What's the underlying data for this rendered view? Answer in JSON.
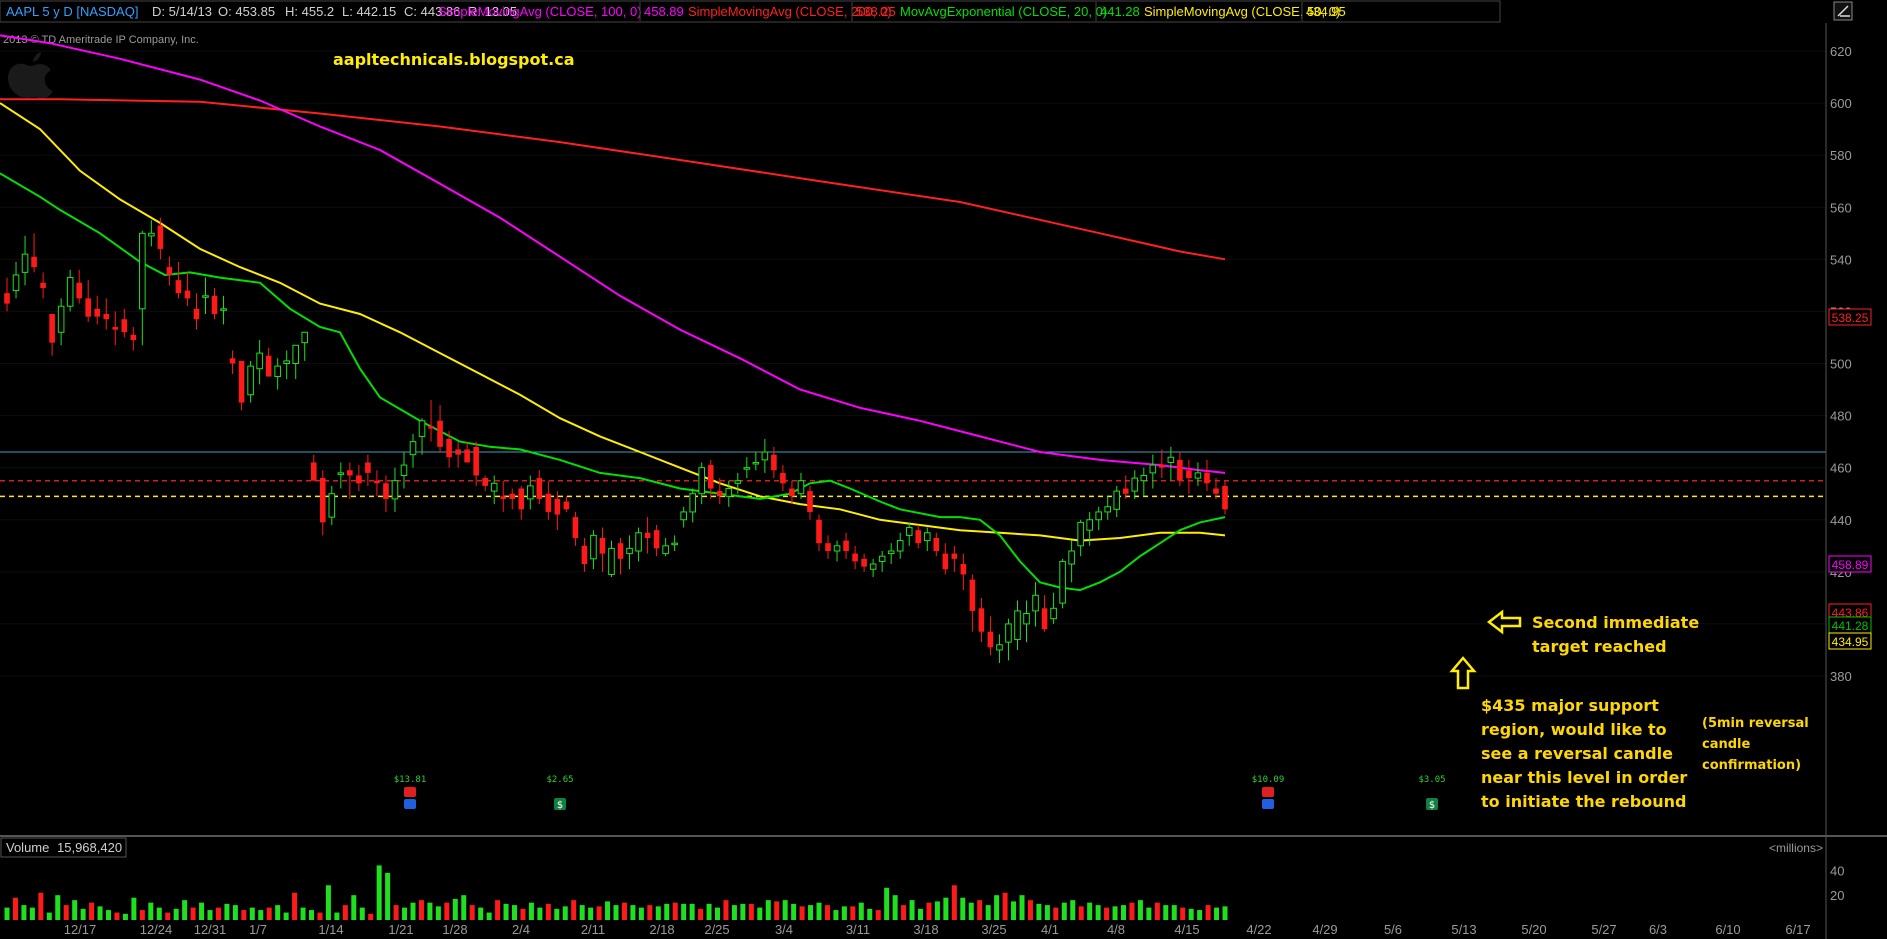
{
  "header": {
    "symbol": "AAPL 5 y D [NASDAQ]",
    "date": "D: 5/14/13",
    "open": "O: 453.85",
    "high": "H: 455.2",
    "low": "L: 442.15",
    "close": "C: 443.86",
    "range": "R: 13.05",
    "studies": [
      {
        "label": "SimpleMovingAvg (CLOSE, 100, 0)",
        "value": "458.89",
        "color": "#ff00ff"
      },
      {
        "label": "SimpleMovingAvg (CLOSE, 200, 0)",
        "value": "538.25",
        "color": "#ff2020"
      },
      {
        "label": "MovAvgExponential (CLOSE, 20, 0)",
        "value": "441.28",
        "color": "#00e000"
      },
      {
        "label": "SimpleMovingAvg (CLOSE, 50, 0)",
        "value": "434.95",
        "color": "#ffee00"
      }
    ]
  },
  "copyright": "2013 © TD Ameritrade IP Company, Inc.",
  "watermark": "aapltechnicals.blogspot.ca",
  "annotations": {
    "target": [
      "Second immediate",
      "target reached"
    ],
    "support": [
      "$435 major support",
      "region, would like to",
      "see a reversal candle",
      "near this level in order",
      "to initiate the rebound"
    ],
    "confirm": [
      "(5min reversal",
      "candle",
      "confirmation)"
    ]
  },
  "events": [
    {
      "label": "$13.81"
    },
    {
      "label": "$2.65"
    },
    {
      "label": "$10.09"
    },
    {
      "label": "$3.05"
    }
  ],
  "volume_panel": {
    "label": "Volume",
    "value": "15,968,420",
    "unit": "<millions>"
  },
  "price_labels": [
    {
      "value": "538.25",
      "color": "#ff2020"
    },
    {
      "value": "458.89",
      "color": "#ff00ff"
    },
    {
      "value": "443.86",
      "color": "#ff2020"
    },
    {
      "value": "441.28",
      "color": "#00c000"
    },
    {
      "value": "434.95",
      "color": "#ffee00"
    }
  ],
  "chart_data": {
    "type": "candlestick",
    "ylim": [
      375,
      628
    ],
    "yticks": [
      380,
      400,
      420,
      440,
      460,
      480,
      500,
      520,
      540,
      560,
      580,
      600,
      620
    ],
    "xticks": [
      "12/17",
      "12/24",
      "12/31",
      "1/7",
      "1/14",
      "1/21",
      "1/28",
      "2/4",
      "2/11",
      "2/18",
      "2/25",
      "3/4",
      "3/11",
      "3/18",
      "3/25",
      "4/1",
      "4/8",
      "4/15",
      "4/22",
      "4/29",
      "5/6",
      "5/13",
      "5/20",
      "5/27",
      "6/3",
      "6/10",
      "6/17"
    ],
    "volume_ylim": [
      0,
      50
    ],
    "volume_yticks": [
      20,
      40
    ],
    "reference_levels": [
      {
        "value": 466,
        "style": "solid",
        "color": "#40a0c0"
      },
      {
        "value": 455,
        "style": "dashed",
        "color": "#d02020"
      },
      {
        "value": 449,
        "style": "dashed",
        "color": "#ffee00"
      }
    ],
    "candles": [
      [
        527,
        533,
        520,
        523
      ],
      [
        528,
        539,
        525,
        534
      ],
      [
        535,
        549,
        530,
        542
      ],
      [
        541,
        550,
        535,
        537
      ],
      [
        531,
        535,
        525,
        529
      ],
      [
        519,
        514,
        503,
        508
      ],
      [
        512,
        525,
        507,
        522
      ],
      [
        522,
        536,
        520,
        533
      ],
      [
        531,
        536,
        523,
        525
      ],
      [
        525,
        532,
        516,
        518
      ],
      [
        521,
        526,
        515,
        518
      ],
      [
        519,
        525,
        513,
        517
      ],
      [
        514,
        520,
        507,
        513
      ],
      [
        517,
        521,
        510,
        512
      ],
      [
        511,
        514,
        505,
        509
      ],
      [
        521,
        551,
        507,
        550
      ],
      [
        549,
        555,
        545,
        550
      ],
      [
        553,
        556,
        540,
        544
      ],
      [
        537,
        541,
        530,
        534
      ],
      [
        532,
        539,
        525,
        527
      ],
      [
        528,
        535,
        522,
        525
      ],
      [
        521,
        527,
        513,
        517
      ],
      [
        526,
        533,
        519,
        526
      ],
      [
        526,
        529,
        517,
        519
      ],
      [
        521,
        526,
        515,
        521
      ],
      [
        502,
        505,
        496,
        500
      ],
      [
        501,
        499,
        482,
        485
      ],
      [
        488,
        501,
        485,
        499
      ],
      [
        498,
        509,
        492,
        504
      ],
      [
        503,
        506,
        495,
        495
      ],
      [
        495,
        502,
        490,
        499
      ],
      [
        500,
        505,
        494,
        501
      ],
      [
        500,
        506,
        494,
        507
      ],
      [
        508,
        512,
        501,
        512
      ],
      [
        462,
        465,
        455,
        455
      ],
      [
        456,
        459,
        434,
        439
      ],
      [
        441,
        453,
        438,
        450
      ],
      [
        458,
        462,
        452,
        458
      ],
      [
        459,
        462,
        448,
        457
      ],
      [
        457,
        461,
        451,
        454
      ],
      [
        462,
        465,
        453,
        458
      ],
      [
        455,
        459,
        449,
        454
      ],
      [
        454,
        457,
        443,
        448
      ],
      [
        448,
        460,
        443,
        455
      ],
      [
        457,
        466,
        452,
        461
      ],
      [
        465,
        473,
        460,
        470
      ],
      [
        472,
        479,
        465,
        478
      ],
      [
        476,
        486,
        470,
        475
      ],
      [
        478,
        484,
        466,
        468
      ],
      [
        471,
        474,
        460,
        464
      ],
      [
        467,
        470,
        460,
        465
      ],
      [
        467,
        470,
        462,
        462
      ],
      [
        468,
        470,
        453,
        457
      ],
      [
        456,
        457,
        451,
        453
      ],
      [
        451,
        457,
        446,
        454
      ],
      [
        449,
        455,
        443,
        448
      ],
      [
        450,
        452,
        444,
        448
      ],
      [
        452,
        453,
        440,
        444
      ],
      [
        448,
        457,
        444,
        453
      ],
      [
        456,
        459,
        446,
        448
      ],
      [
        450,
        455,
        440,
        443
      ],
      [
        448,
        451,
        436,
        442
      ],
      [
        447,
        449,
        443,
        444
      ],
      [
        441,
        443,
        430,
        433
      ],
      [
        430,
        433,
        420,
        423
      ],
      [
        425,
        436,
        421,
        434
      ],
      [
        433,
        437,
        420,
        427
      ],
      [
        419,
        432,
        418,
        429
      ],
      [
        431,
        433,
        419,
        425
      ],
      [
        427,
        434,
        421,
        429
      ],
      [
        428,
        437,
        424,
        435
      ],
      [
        435,
        441,
        427,
        433
      ],
      [
        436,
        438,
        426,
        429
      ],
      [
        427,
        433,
        426,
        430
      ],
      [
        431,
        434,
        428,
        431
      ],
      [
        440,
        445,
        437,
        443
      ],
      [
        443,
        452,
        439,
        450
      ],
      [
        450,
        462,
        446,
        460
      ],
      [
        461,
        463,
        448,
        452
      ],
      [
        451,
        456,
        446,
        449
      ],
      [
        449,
        455,
        445,
        452
      ],
      [
        454,
        458,
        450,
        455
      ],
      [
        460,
        464,
        456,
        460
      ],
      [
        462,
        466,
        459,
        462
      ],
      [
        463,
        471,
        458,
        466
      ],
      [
        465,
        468,
        456,
        459
      ],
      [
        458,
        461,
        451,
        454
      ],
      [
        452,
        455,
        446,
        449
      ],
      [
        450,
        458,
        448,
        455
      ],
      [
        451,
        453,
        440,
        443
      ],
      [
        440,
        442,
        428,
        431
      ],
      [
        431,
        434,
        425,
        428
      ],
      [
        428,
        432,
        424,
        430
      ],
      [
        432,
        435,
        425,
        428
      ],
      [
        427,
        430,
        421,
        424
      ],
      [
        425,
        427,
        420,
        422
      ],
      [
        421,
        425,
        418,
        423
      ],
      [
        424,
        428,
        420,
        426
      ],
      [
        427,
        431,
        423,
        428
      ],
      [
        428,
        435,
        425,
        432
      ],
      [
        434,
        439,
        430,
        437
      ],
      [
        436,
        438,
        429,
        431
      ],
      [
        432,
        437,
        428,
        435
      ],
      [
        433,
        435,
        426,
        428
      ],
      [
        427,
        431,
        419,
        421
      ],
      [
        427,
        430,
        420,
        425
      ],
      [
        423,
        427,
        413,
        419
      ],
      [
        417,
        419,
        397,
        405
      ],
      [
        406,
        410,
        393,
        397
      ],
      [
        397,
        403,
        388,
        391
      ],
      [
        390,
        396,
        385,
        392
      ],
      [
        393,
        402,
        386,
        400
      ],
      [
        394,
        409,
        390,
        405
      ],
      [
        400,
        409,
        393,
        404
      ],
      [
        405,
        416,
        399,
        411
      ],
      [
        406,
        411,
        397,
        398
      ],
      [
        402,
        412,
        400,
        406
      ],
      [
        408,
        425,
        406,
        424
      ],
      [
        423,
        432,
        416,
        428
      ],
      [
        430,
        440,
        426,
        439
      ],
      [
        436,
        443,
        430,
        440
      ],
      [
        440,
        445,
        436,
        443
      ],
      [
        443,
        449,
        440,
        445
      ],
      [
        444,
        453,
        441,
        451
      ],
      [
        452,
        457,
        448,
        450
      ],
      [
        451,
        459,
        448,
        456
      ],
      [
        455,
        460,
        449,
        457
      ],
      [
        458,
        465,
        452,
        461
      ],
      [
        461,
        467,
        456,
        460
      ],
      [
        462,
        468,
        455,
        464
      ],
      [
        463,
        466,
        453,
        455
      ],
      [
        459,
        463,
        450,
        456
      ],
      [
        456,
        462,
        453,
        458
      ],
      [
        458,
        463,
        451,
        454
      ],
      [
        452,
        456,
        448,
        450
      ],
      [
        453,
        455,
        442,
        444
      ]
    ],
    "volume": [
      10,
      18,
      12,
      10,
      22,
      6,
      20,
      12,
      16,
      9,
      14,
      11,
      8,
      6,
      5,
      18,
      8,
      14,
      10,
      6,
      9,
      16,
      10,
      14,
      8,
      10,
      13,
      12,
      8,
      10,
      8,
      10,
      12,
      6,
      22,
      10,
      8,
      6,
      28,
      6,
      12,
      20,
      10,
      5,
      44,
      38,
      12,
      10,
      14,
      16,
      14,
      11,
      14,
      17,
      20,
      12,
      10,
      6,
      16,
      13,
      12,
      9,
      14,
      10,
      13,
      9,
      11,
      16,
      12,
      10,
      11,
      15,
      12,
      14,
      12,
      10,
      12,
      11,
      13,
      14,
      13,
      13,
      9,
      13,
      10,
      16,
      12,
      13,
      13,
      10,
      16,
      15,
      16,
      13,
      11,
      12,
      14,
      12,
      8,
      11,
      11,
      14,
      9,
      8,
      26,
      20,
      12,
      16,
      9,
      14,
      15,
      18,
      28,
      18,
      14,
      16,
      12,
      20,
      22,
      15,
      20,
      16,
      13,
      12,
      10,
      14,
      16,
      11,
      14,
      12,
      10,
      11,
      12,
      14,
      16,
      10,
      14,
      12,
      12,
      10,
      9,
      8,
      12,
      10,
      11
    ],
    "sma200": [
      [
        0,
        601.5
      ],
      [
        60,
        601.5
      ],
      [
        200,
        600.5
      ],
      [
        320,
        596
      ],
      [
        440,
        591
      ],
      [
        560,
        585
      ],
      [
        700,
        577
      ],
      [
        820,
        570
      ],
      [
        960,
        562
      ],
      [
        1100,
        550
      ],
      [
        1180,
        543
      ],
      [
        1225,
        540
      ]
    ],
    "sma100": [
      [
        0,
        626
      ],
      [
        50,
        623
      ],
      [
        120,
        617
      ],
      [
        200,
        609
      ],
      [
        260,
        601
      ],
      [
        320,
        591
      ],
      [
        380,
        582
      ],
      [
        440,
        569
      ],
      [
        500,
        556
      ],
      [
        560,
        541
      ],
      [
        620,
        526
      ],
      [
        680,
        513
      ],
      [
        740,
        502
      ],
      [
        800,
        490
      ],
      [
        860,
        483
      ],
      [
        920,
        478
      ],
      [
        980,
        472
      ],
      [
        1040,
        466
      ],
      [
        1100,
        463
      ],
      [
        1160,
        461
      ],
      [
        1200,
        459
      ],
      [
        1225,
        458
      ]
    ],
    "sma50": [
      [
        0,
        600
      ],
      [
        40,
        590
      ],
      [
        80,
        574
      ],
      [
        120,
        563
      ],
      [
        160,
        554
      ],
      [
        200,
        544
      ],
      [
        240,
        537
      ],
      [
        280,
        531
      ],
      [
        320,
        523
      ],
      [
        360,
        519
      ],
      [
        400,
        512
      ],
      [
        440,
        504
      ],
      [
        480,
        496
      ],
      [
        520,
        488
      ],
      [
        560,
        479
      ],
      [
        600,
        472
      ],
      [
        640,
        466
      ],
      [
        680,
        460
      ],
      [
        720,
        454
      ],
      [
        760,
        449
      ],
      [
        800,
        446
      ],
      [
        840,
        444
      ],
      [
        880,
        440
      ],
      [
        920,
        438
      ],
      [
        960,
        436
      ],
      [
        1000,
        435
      ],
      [
        1040,
        434
      ],
      [
        1080,
        432
      ],
      [
        1120,
        433
      ],
      [
        1160,
        435
      ],
      [
        1200,
        435
      ],
      [
        1225,
        434
      ]
    ],
    "ema20": [
      [
        0,
        573
      ],
      [
        40,
        564
      ],
      [
        60,
        559
      ],
      [
        100,
        550
      ],
      [
        140,
        539
      ],
      [
        165,
        534
      ],
      [
        190,
        535
      ],
      [
        220,
        533
      ],
      [
        260,
        531
      ],
      [
        290,
        521
      ],
      [
        320,
        514
      ],
      [
        340,
        512
      ],
      [
        360,
        498
      ],
      [
        380,
        487
      ],
      [
        420,
        478
      ],
      [
        460,
        470
      ],
      [
        490,
        468
      ],
      [
        520,
        467
      ],
      [
        560,
        463
      ],
      [
        600,
        458
      ],
      [
        640,
        456
      ],
      [
        680,
        452
      ],
      [
        720,
        450
      ],
      [
        760,
        448
      ],
      [
        790,
        450
      ],
      [
        810,
        454
      ],
      [
        830,
        455
      ],
      [
        850,
        452
      ],
      [
        880,
        447
      ],
      [
        900,
        444
      ],
      [
        940,
        441
      ],
      [
        960,
        441
      ],
      [
        980,
        440
      ],
      [
        1000,
        434
      ],
      [
        1020,
        424
      ],
      [
        1040,
        416
      ],
      [
        1060,
        414
      ],
      [
        1080,
        413
      ],
      [
        1100,
        416
      ],
      [
        1120,
        420
      ],
      [
        1140,
        426
      ],
      [
        1160,
        431
      ],
      [
        1180,
        436
      ],
      [
        1200,
        439
      ],
      [
        1225,
        441
      ]
    ]
  }
}
